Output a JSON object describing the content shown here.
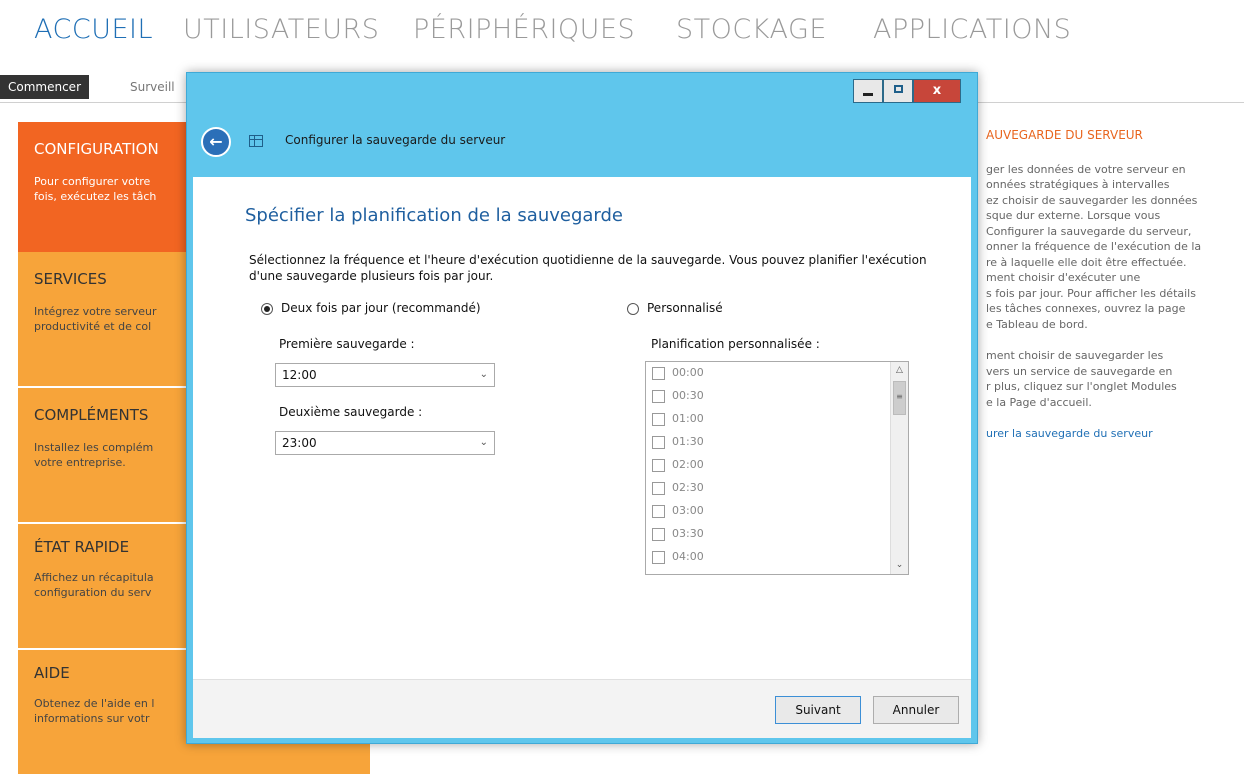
{
  "topnav": {
    "items": [
      "ACCUEIL",
      "UTILISATEURS",
      "PÉRIPHÉRIQUES",
      "STOCKAGE",
      "APPLICATIONS"
    ],
    "active_index": 0
  },
  "subtabs": {
    "items": [
      "Commencer",
      "Surveill"
    ],
    "active_index": 0
  },
  "tiles": [
    {
      "title": "CONFIGURATION",
      "desc": "Pour configurer votre\nfois, exécutez les tâch",
      "color": "#f26522"
    },
    {
      "title": "SERVICES",
      "desc": "Intégrez votre serveur\nproductivité et de col",
      "color": "#f7a43a"
    },
    {
      "title": "COMPLÉMENTS",
      "desc": "Installez les complém\nvotre entreprise.",
      "color": "#f7a43a"
    },
    {
      "title": "ÉTAT RAPIDE",
      "desc": "Affichez un récapitula\nconfiguration du serv",
      "color": "#f7a43a"
    },
    {
      "title": "AIDE",
      "desc": "Obtenez de l'aide en l\ninformations sur votr",
      "color": "#f7a43a"
    }
  ],
  "info": {
    "title": "AUVEGARDE DU SERVEUR",
    "para1": "ger les données de votre serveur en\nonnées stratégiques à intervalles\nez choisir de sauvegarder les données\nsque dur externe. Lorsque vous\nConfigurer la sauvegarde du serveur,\nonner la fréquence de l'exécution de la\nre à laquelle elle doit être effectuée.\nment choisir d'exécuter une\ns fois par jour. Pour afficher les détails\nles tâches connexes, ouvrez la page\ne Tableau de bord.",
    "para2": "ment choisir de sauvegarder les\nvers un service de sauvegarde en\nr plus, cliquez sur l'onglet Modules\ne la Page d'accueil.",
    "link": "urer la sauvegarde du serveur"
  },
  "dialog": {
    "window_buttons": {
      "minimize": "▁",
      "maximize": "□",
      "close": "x"
    },
    "header_title": "Configurer la sauvegarde du serveur",
    "heading": "Spécifier la planification de la sauvegarde",
    "description": "Sélectionnez la fréquence et l'heure d'exécution quotidienne de la sauvegarde. Vous pouvez planifier l'exécution d'une sauvegarde plusieurs fois par jour.",
    "option_twice": "Deux fois par jour (recommandé)",
    "option_twice_checked": true,
    "option_custom": "Personnalisé",
    "option_custom_checked": false,
    "first_label": "Première sauvegarde :",
    "first_value": "12:00",
    "second_label": "Deuxième sauvegarde :",
    "second_value": "23:00",
    "custom_label": "Planification personnalisée :",
    "custom_times": [
      "00:00",
      "00:30",
      "01:00",
      "01:30",
      "02:00",
      "02:30",
      "03:00",
      "03:30",
      "04:00"
    ],
    "next_button": "Suivant",
    "cancel_button": "Annuler"
  }
}
